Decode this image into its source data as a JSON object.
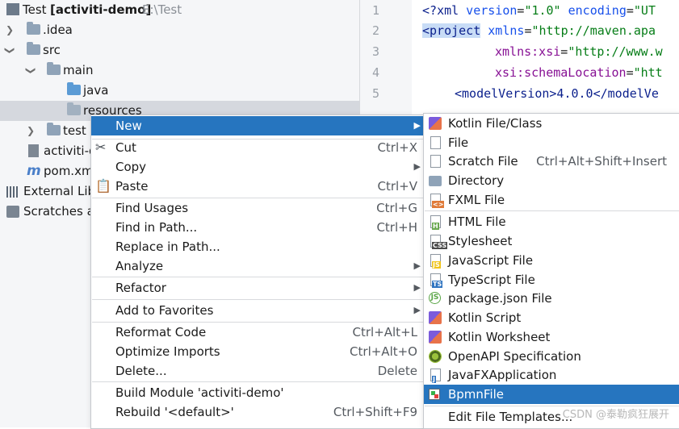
{
  "project_tree": {
    "root": {
      "name": "Test",
      "module": "[activiti-demo]",
      "path": "E:\\Test"
    },
    "items": [
      {
        "label": ".idea"
      },
      {
        "label": "src"
      },
      {
        "label": "main"
      },
      {
        "label": "java"
      },
      {
        "label": "resources"
      },
      {
        "label": "test"
      },
      {
        "label": "activiti-d"
      },
      {
        "label": "pom.xml"
      },
      {
        "label": "External Lib"
      },
      {
        "label": "Scratches ar"
      }
    ]
  },
  "editor": {
    "line_numbers": [
      "1",
      "2",
      "3",
      "4",
      "5"
    ],
    "line1": {
      "a": "<?",
      "b": "xml",
      "c": " version",
      "d": "=",
      "e": "\"1.0\"",
      "f": " encoding",
      "g": "=",
      "h": "\"UT"
    },
    "line2": {
      "a": "<",
      "b": "project",
      "c": " xmlns",
      "d": "=",
      "e": "\"http://maven.apa"
    },
    "line3": {
      "a": "xmlns:xsi",
      "b": "=",
      "c": "\"http://www.w"
    },
    "line4": {
      "a": "xsi:schemaLocation",
      "b": "=",
      "c": "\"htt"
    },
    "line5": {
      "a": "<",
      "b": "modelVersion",
      "c": ">4.0.0</",
      "d": "modelVe"
    }
  },
  "context_menu": {
    "items": [
      {
        "label": "New",
        "shortcut": ""
      },
      {
        "label": "Cut",
        "shortcut": "Ctrl+X"
      },
      {
        "label": "Copy",
        "shortcut": ""
      },
      {
        "label": "Paste",
        "shortcut": "Ctrl+V"
      },
      {
        "label": "Find Usages",
        "shortcut": "Ctrl+G"
      },
      {
        "label": "Find in Path...",
        "shortcut": "Ctrl+H"
      },
      {
        "label": "Replace in Path...",
        "shortcut": ""
      },
      {
        "label": "Analyze",
        "shortcut": ""
      },
      {
        "label": "Refactor",
        "shortcut": ""
      },
      {
        "label": "Add to Favorites",
        "shortcut": ""
      },
      {
        "label": "Reformat Code",
        "shortcut": "Ctrl+Alt+L"
      },
      {
        "label": "Optimize Imports",
        "shortcut": "Ctrl+Alt+O"
      },
      {
        "label": "Delete...",
        "shortcut": "Delete"
      },
      {
        "label": "Build Module 'activiti-demo'",
        "shortcut": ""
      },
      {
        "label": "Rebuild '<default>'",
        "shortcut": "Ctrl+Shift+F9"
      }
    ]
  },
  "new_submenu": {
    "items": [
      {
        "label": "Kotlin File/Class",
        "shortcut": "",
        "icon": "kotlin-icon"
      },
      {
        "label": "File",
        "shortcut": "",
        "icon": "file-icon"
      },
      {
        "label": "Scratch File",
        "shortcut": "Ctrl+Alt+Shift+Insert",
        "icon": "scratch-file-icon"
      },
      {
        "label": "Directory",
        "shortcut": "",
        "icon": "folder-icon"
      },
      {
        "label": "FXML File",
        "shortcut": "",
        "icon": "fxml-icon"
      },
      {
        "label": "HTML File",
        "shortcut": "",
        "icon": "html-icon"
      },
      {
        "label": "Stylesheet",
        "shortcut": "",
        "icon": "css-icon"
      },
      {
        "label": "JavaScript File",
        "shortcut": "",
        "icon": "js-icon"
      },
      {
        "label": "TypeScript File",
        "shortcut": "",
        "icon": "ts-icon"
      },
      {
        "label": "package.json File",
        "shortcut": "",
        "icon": "nodejs-icon"
      },
      {
        "label": "Kotlin Script",
        "shortcut": "",
        "icon": "kotlin-icon"
      },
      {
        "label": "Kotlin Worksheet",
        "shortcut": "",
        "icon": "kotlin-icon"
      },
      {
        "label": "OpenAPI Specification",
        "shortcut": "",
        "icon": "openapi-icon"
      },
      {
        "label": "JavaFXApplication",
        "shortcut": "",
        "icon": "javafx-icon"
      },
      {
        "label": "BpmnFile",
        "shortcut": "",
        "icon": "bpmn-icon"
      },
      {
        "label": "Edit File Templates...",
        "shortcut": "",
        "icon": ""
      }
    ],
    "badges": {
      "js": "JS",
      "ts": "TS",
      "css": "CSS",
      "html": "H",
      "fxml": "<>",
      "javafx": "J"
    }
  },
  "watermark": "CSDN @泰勒疯狂展开",
  "colors": {
    "selection": "#2675bf",
    "tree_selection": "#d5d8de",
    "xml_tag": "#0a1f8c",
    "xml_string": "#067d17"
  }
}
